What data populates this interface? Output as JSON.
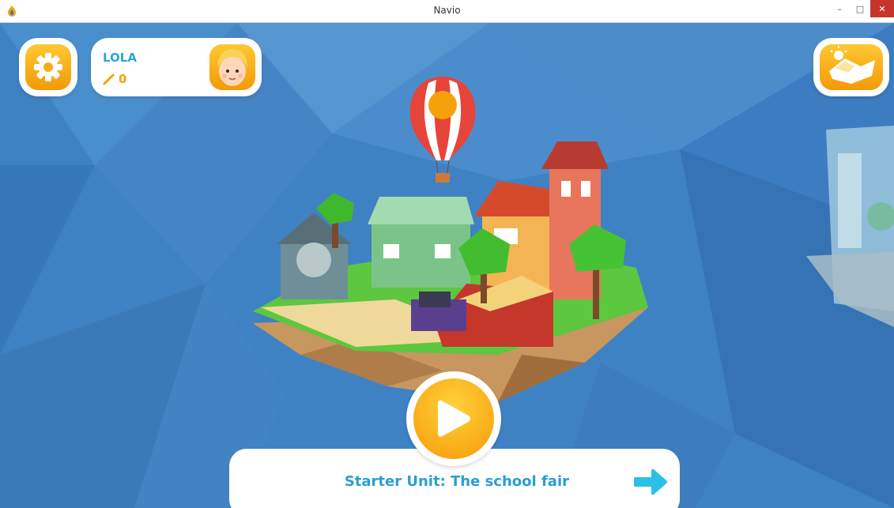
{
  "window": {
    "title": "Navio",
    "controls": [
      "–",
      "□",
      "✕"
    ]
  },
  "colors": {
    "accent_orange": "#f5a20a",
    "text_blue": "#2aa7d8",
    "sky": "#3d7fc0",
    "close_red": "#c7342a"
  },
  "profile": {
    "name": "LOLA",
    "score": "0",
    "score_icon": "pencil-icon",
    "avatar": "avatar-girl-icon"
  },
  "settings": {
    "icon": "gear-icon"
  },
  "map": {
    "icon": "map-island-icon"
  },
  "play": {
    "icon": "play-icon"
  },
  "unit": {
    "title": "Starter Unit: The school fair",
    "next_icon": "arrow-right-icon"
  }
}
